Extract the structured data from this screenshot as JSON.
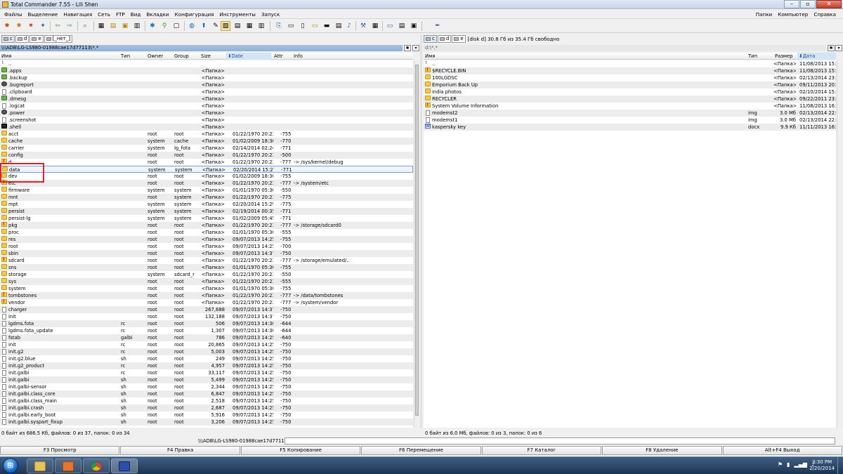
{
  "window": {
    "title": "Total Commander 7.55 - Lili Shen"
  },
  "menu": {
    "left": [
      "Файлы",
      "Выделение",
      "Навигация",
      "Сеть",
      "FTP",
      "Вид",
      "Вкладки",
      "Конфигурация",
      "Инструменты",
      "Запуск"
    ],
    "right": [
      "Папки",
      "Компьютер",
      "Справка"
    ]
  },
  "left": {
    "drives": [
      "c",
      "d",
      "e",
      "[_нет_]"
    ],
    "path": "\\\\\\ADB\\LG-LS980-01988cae17d77113\\*.*",
    "columns": {
      "name": "Имя",
      "type": "Тип",
      "owner": "Owner",
      "group": "Group",
      "size": "Size",
      "date": "Date",
      "attr": "Attr",
      "info": "Info"
    },
    "rows": [
      {
        "icon": "up",
        "name": "..",
        "type": "",
        "owner": "",
        "group": "",
        "size": "",
        "date": "",
        "attr": "",
        "info": ""
      },
      {
        "icon": "green",
        "name": ".apps",
        "type": "",
        "owner": "",
        "group": "",
        "size": "<Папка>",
        "date": "",
        "attr": "",
        "info": ""
      },
      {
        "icon": "green",
        "name": ".backup",
        "type": "",
        "owner": "",
        "group": "",
        "size": "<Папка>",
        "date": "",
        "attr": "",
        "info": ""
      },
      {
        "icon": "gear",
        "name": ".bugreport",
        "type": "",
        "owner": "",
        "group": "",
        "size": "<Папка>",
        "date": "",
        "attr": "",
        "info": ""
      },
      {
        "icon": "file",
        "name": ".clipboard",
        "type": "",
        "owner": "",
        "group": "",
        "size": "<Папка>",
        "date": "",
        "attr": "",
        "info": ""
      },
      {
        "icon": "green",
        "name": ".dmesg",
        "type": "",
        "owner": "",
        "group": "",
        "size": "<Папка>",
        "date": "",
        "attr": "",
        "info": ""
      },
      {
        "icon": "file",
        "name": ".logcat",
        "type": "",
        "owner": "",
        "group": "",
        "size": "<Папка>",
        "date": "",
        "attr": "",
        "info": ""
      },
      {
        "icon": "gear",
        "name": ".power",
        "type": "",
        "owner": "",
        "group": "",
        "size": "<Папка>",
        "date": "",
        "attr": "",
        "info": ""
      },
      {
        "icon": "file",
        "name": ".screenshot",
        "type": "",
        "owner": "",
        "group": "",
        "size": "<Папка>",
        "date": "",
        "attr": "",
        "info": ""
      },
      {
        "icon": "black",
        "name": ".shell",
        "type": "",
        "owner": "",
        "group": "",
        "size": "<Папка>",
        "date": "",
        "attr": "",
        "info": ""
      },
      {
        "icon": "folder",
        "name": "acct",
        "type": "",
        "owner": "root",
        "group": "root",
        "size": "<Папка>",
        "date": "01/22/1970 20:23",
        "attr": "-755",
        "info": ""
      },
      {
        "icon": "folder",
        "name": "cache",
        "type": "",
        "owner": "system",
        "group": "cache",
        "size": "<Папка>",
        "date": "01/02/2009 18:30",
        "attr": "-770",
        "info": ""
      },
      {
        "icon": "folder",
        "name": "carrier",
        "type": "",
        "owner": "system",
        "group": "lg_fota",
        "size": "<Папка>",
        "date": "02/14/2014 02:24",
        "attr": "-771",
        "info": ""
      },
      {
        "icon": "folder",
        "name": "config",
        "type": "",
        "owner": "root",
        "group": "root",
        "size": "<Папка>",
        "date": "01/22/1970 20:23",
        "attr": "-500",
        "info": ""
      },
      {
        "icon": "link",
        "name": "d",
        "type": "",
        "owner": "root",
        "group": "root",
        "size": "<Папка>",
        "date": "01/22/1970 20:23",
        "attr": "-777",
        "info": "-> /sys/kernel/debug"
      },
      {
        "icon": "folder",
        "name": "data",
        "type": "",
        "owner": "system",
        "group": "system",
        "size": "<Папка>",
        "date": "02/20/2014 15:27",
        "attr": "-771",
        "info": ""
      },
      {
        "icon": "folder",
        "name": "dev",
        "type": "",
        "owner": "root",
        "group": "root",
        "size": "<Папка>",
        "date": "01/02/2009 18:30",
        "attr": "-755",
        "info": ""
      },
      {
        "icon": "link",
        "name": "etc",
        "type": "",
        "owner": "root",
        "group": "root",
        "size": "<Папка>",
        "date": "01/22/1970 20:23",
        "attr": "-777",
        "info": "-> /system/etc"
      },
      {
        "icon": "folder",
        "name": "firmware",
        "type": "",
        "owner": "system",
        "group": "system",
        "size": "<Папка>",
        "date": "01/01/1970 05:30",
        "attr": "-550",
        "info": ""
      },
      {
        "icon": "folder",
        "name": "mnt",
        "type": "",
        "owner": "root",
        "group": "system",
        "size": "<Папка>",
        "date": "01/22/1970 20:23",
        "attr": "-775",
        "info": ""
      },
      {
        "icon": "folder",
        "name": "mpt",
        "type": "",
        "owner": "system",
        "group": "system",
        "size": "<Папка>",
        "date": "02/20/2014 15:29",
        "attr": "-775",
        "info": ""
      },
      {
        "icon": "folder",
        "name": "persist",
        "type": "",
        "owner": "system",
        "group": "system",
        "size": "<Папка>",
        "date": "02/19/2014 00:35",
        "attr": "-771",
        "info": ""
      },
      {
        "icon": "folder",
        "name": "persist-lg",
        "type": "",
        "owner": "system",
        "group": "system",
        "size": "<Папка>",
        "date": "01/02/2009 05:45",
        "attr": "-771",
        "info": ""
      },
      {
        "icon": "link",
        "name": "pkg",
        "type": "",
        "owner": "root",
        "group": "root",
        "size": "<Папка>",
        "date": "01/22/1970 20:23",
        "attr": "-777",
        "info": "-> /storage/sdcard0"
      },
      {
        "icon": "folder",
        "name": "proc",
        "type": "",
        "owner": "root",
        "group": "root",
        "size": "<Папка>",
        "date": "01/01/1970 05:30",
        "attr": "-555",
        "info": ""
      },
      {
        "icon": "folder",
        "name": "res",
        "type": "",
        "owner": "root",
        "group": "root",
        "size": "<Папка>",
        "date": "09/07/2013 14:25",
        "attr": "-755",
        "info": ""
      },
      {
        "icon": "folder",
        "name": "root",
        "type": "",
        "owner": "root",
        "group": "root",
        "size": "<Папка>",
        "date": "09/07/2013 14:25",
        "attr": "-700",
        "info": ""
      },
      {
        "icon": "folder",
        "name": "sbin",
        "type": "",
        "owner": "root",
        "group": "root",
        "size": "<Папка>",
        "date": "09/07/2013 14:37",
        "attr": "-750",
        "info": ""
      },
      {
        "icon": "link",
        "name": "sdcard",
        "type": "",
        "owner": "root",
        "group": "root",
        "size": "<Папка>",
        "date": "01/22/1970 20:23",
        "attr": "-777",
        "info": "-> /storage/emulated/.."
      },
      {
        "icon": "folder",
        "name": "sns",
        "type": "",
        "owner": "root",
        "group": "root",
        "size": "<Папка>",
        "date": "01/01/1970 05:30",
        "attr": "-755",
        "info": ""
      },
      {
        "icon": "folder",
        "name": "storage",
        "type": "",
        "owner": "system",
        "group": "sdcard_r",
        "size": "<Папка>",
        "date": "01/22/1970 20:23",
        "attr": "-550",
        "info": ""
      },
      {
        "icon": "folder",
        "name": "sys",
        "type": "",
        "owner": "root",
        "group": "root",
        "size": "<Папка>",
        "date": "01/22/1970 20:23",
        "attr": "-555",
        "info": ""
      },
      {
        "icon": "folder",
        "name": "system",
        "type": "",
        "owner": "root",
        "group": "root",
        "size": "<Папка>",
        "date": "01/01/1970 05:30",
        "attr": "-755",
        "info": ""
      },
      {
        "icon": "link",
        "name": "tombstones",
        "type": "",
        "owner": "root",
        "group": "root",
        "size": "<Папка>",
        "date": "01/22/1970 20:23",
        "attr": "-777",
        "info": "-> /data/tombstones"
      },
      {
        "icon": "link",
        "name": "vendor",
        "type": "",
        "owner": "root",
        "group": "root",
        "size": "<Папка>",
        "date": "01/22/1970 20:23",
        "attr": "-777",
        "info": "-> /system/vendor"
      },
      {
        "icon": "file",
        "name": "charger",
        "type": "",
        "owner": "root",
        "group": "root",
        "size": "267,688",
        "date": "09/07/2013 14:37",
        "attr": "-750",
        "info": ""
      },
      {
        "icon": "file",
        "name": "init",
        "type": "",
        "owner": "root",
        "group": "root",
        "size": "132,188",
        "date": "09/07/2013 14:37",
        "attr": "-750",
        "info": ""
      },
      {
        "icon": "file",
        "name": "lgdms.fota",
        "type": "rc",
        "owner": "root",
        "group": "root",
        "size": "506",
        "date": "09/07/2013 14:30",
        "attr": "-644",
        "info": ""
      },
      {
        "icon": "file",
        "name": "lgdms.fota_update",
        "type": "rc",
        "owner": "root",
        "group": "root",
        "size": "1,307",
        "date": "09/07/2013 14:30",
        "attr": "-644",
        "info": ""
      },
      {
        "icon": "file",
        "name": "fstab",
        "type": "galbi",
        "owner": "root",
        "group": "root",
        "size": "786",
        "date": "09/07/2013 14:25",
        "attr": "-640",
        "info": ""
      },
      {
        "icon": "file",
        "name": "init",
        "type": "rc",
        "owner": "root",
        "group": "root",
        "size": "20,865",
        "date": "09/07/2013 14:25",
        "attr": "-750",
        "info": ""
      },
      {
        "icon": "file",
        "name": "init.g2",
        "type": "rc",
        "owner": "root",
        "group": "root",
        "size": "5,003",
        "date": "09/07/2013 14:25",
        "attr": "-750",
        "info": ""
      },
      {
        "icon": "file",
        "name": "init.g2.blue",
        "type": "sh",
        "owner": "root",
        "group": "root",
        "size": "249",
        "date": "09/07/2013 14:25",
        "attr": "-750",
        "info": ""
      },
      {
        "icon": "file",
        "name": "init.g2_product",
        "type": "rc",
        "owner": "root",
        "group": "root",
        "size": "4,957",
        "date": "09/07/2013 14:25",
        "attr": "-750",
        "info": ""
      },
      {
        "icon": "file",
        "name": "init.galbi",
        "type": "rc",
        "owner": "root",
        "group": "root",
        "size": "33,117",
        "date": "09/07/2013 14:25",
        "attr": "-750",
        "info": ""
      },
      {
        "icon": "file",
        "name": "init.galbi",
        "type": "sh",
        "owner": "root",
        "group": "root",
        "size": "5,499",
        "date": "09/07/2013 14:25",
        "attr": "-750",
        "info": ""
      },
      {
        "icon": "file",
        "name": "init.galbi-sensor",
        "type": "sh",
        "owner": "root",
        "group": "root",
        "size": "2,344",
        "date": "09/07/2013 14:25",
        "attr": "-750",
        "info": ""
      },
      {
        "icon": "file",
        "name": "init.galbi.class_core",
        "type": "sh",
        "owner": "root",
        "group": "root",
        "size": "6,847",
        "date": "09/07/2013 14:25",
        "attr": "-750",
        "info": ""
      },
      {
        "icon": "file",
        "name": "init.galbi.class_main",
        "type": "sh",
        "owner": "root",
        "group": "root",
        "size": "2,518",
        "date": "09/07/2013 14:25",
        "attr": "-750",
        "info": ""
      },
      {
        "icon": "file",
        "name": "init.galbi.crash",
        "type": "sh",
        "owner": "root",
        "group": "root",
        "size": "2,687",
        "date": "09/07/2013 14:25",
        "attr": "-750",
        "info": ""
      },
      {
        "icon": "file",
        "name": "init.galbi.early_boot",
        "type": "sh",
        "owner": "root",
        "group": "root",
        "size": "5,916",
        "date": "09/07/2013 14:25",
        "attr": "-750",
        "info": ""
      },
      {
        "icon": "file",
        "name": "init.galbi.syspart_fixup",
        "type": "sh",
        "owner": "root",
        "group": "root",
        "size": "3,206",
        "date": "09/07/2013 14:25",
        "attr": "-750",
        "info": ""
      }
    ],
    "status": "0 байт из 686.5 Кб, файлов: 0 из 37, папок: 0 из 34"
  },
  "right": {
    "drives": [
      "c",
      "d",
      "e"
    ],
    "diskinfo": "[disk d]  30.8 Гб из 35.4 Гб свободно",
    "path": "d:\\*.*",
    "columns": {
      "name": "Имя",
      "type": "Тип",
      "size": "Размер",
      "date": "Дата"
    },
    "rows": [
      {
        "icon": "up",
        "name": "..",
        "type": "",
        "size": "<Папка>",
        "date": "11/08/2013 15:47"
      },
      {
        "icon": "link",
        "name": "$RECYCLE.BIN",
        "type": "",
        "size": "<Папка>",
        "date": "11/08/2013 15:47"
      },
      {
        "icon": "folder",
        "name": "100LGDSC",
        "type": "",
        "size": "<Папка>",
        "date": "02/13/2014 23:36"
      },
      {
        "icon": "folder",
        "name": "Emporium Back Up",
        "type": "",
        "size": "<Папка>",
        "date": "09/11/2013 20:35"
      },
      {
        "icon": "folder",
        "name": "india photos",
        "type": "",
        "size": "<Папка>",
        "date": "02/10/2014 15:11"
      },
      {
        "icon": "folder",
        "name": "RECYCLER",
        "type": "",
        "size": "<Папка>",
        "date": "09/22/2011 23:30"
      },
      {
        "icon": "link",
        "name": "System Volume Information",
        "type": "",
        "size": "<Папка>",
        "date": "11/08/2013 16:08"
      },
      {
        "icon": "file",
        "name": "modemst2",
        "type": "img",
        "size": "3.0 Мб",
        "date": "02/13/2014 22:20"
      },
      {
        "icon": "file",
        "name": "modemst1",
        "type": "img",
        "size": "3.0 Мб",
        "date": "02/13/2014 22:20"
      },
      {
        "icon": "doc",
        "name": "kaspersky key",
        "type": "docx",
        "size": "9.9 Кб",
        "date": "11/11/2013 16:36"
      }
    ],
    "status": "0 байт из 6.0 Мб, файлов: 0 из 3, папок: 0 из 6"
  },
  "cmdline": {
    "prompt": "\\\\\\ADB\\LG-LS980-01988cae17d77113>"
  },
  "fkeys": [
    "F3 Просмотр",
    "F4 Правка",
    "F5 Копирование",
    "F6 Перемещение",
    "F7 Каталог",
    "F8 Удаление",
    "Alt+F4 Выход"
  ],
  "taskbar": {
    "time": "3:30 PM",
    "date": "2/20/2014"
  },
  "colors": {
    "accent": "#a7c2e2",
    "highlight": "#e0202a",
    "folder": "#f3c843"
  }
}
